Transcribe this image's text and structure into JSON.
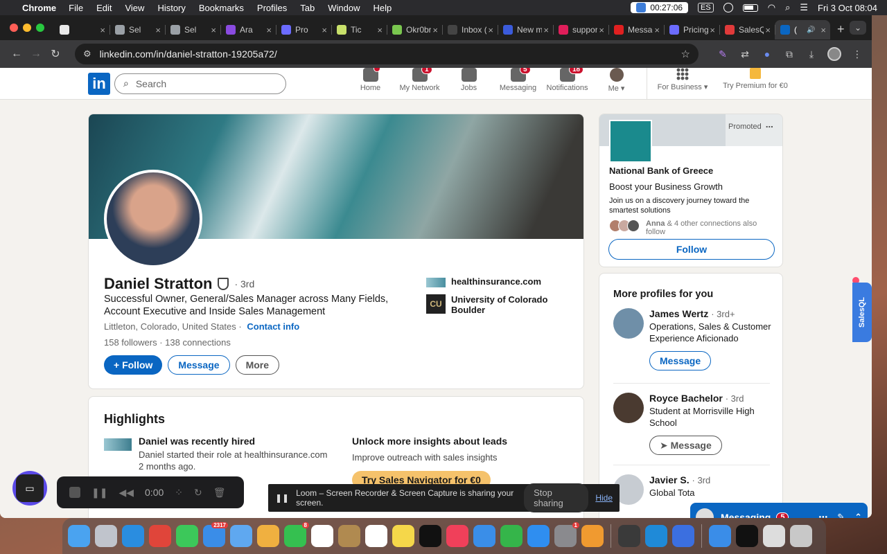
{
  "menubar": {
    "app_name": "Chrome",
    "menus": [
      "File",
      "Edit",
      "View",
      "History",
      "Bookmarks",
      "Profiles",
      "Tab",
      "Window",
      "Help"
    ],
    "timer": "00:27:06",
    "input_source": "ES",
    "datetime": "Fri 3 Oct  08:04"
  },
  "tabs": [
    {
      "label": "",
      "color": "#e9e9e9"
    },
    {
      "label": "Sel",
      "color": "#9aa0a6"
    },
    {
      "label": "Sel",
      "color": "#9aa0a6"
    },
    {
      "label": "Ara",
      "color": "#8a4be0"
    },
    {
      "label": "Pro",
      "color": "#6b6bff"
    },
    {
      "label": "Tic",
      "color": "#c8e06a"
    },
    {
      "label": "Okr0br",
      "color": "#7ac74f"
    },
    {
      "label": "Inbox (",
      "color": "#444"
    },
    {
      "label": "New m",
      "color": "#3b5bdb"
    },
    {
      "label": "suppor",
      "color": "#e01e5a"
    },
    {
      "label": "Messag",
      "color": "#e02020"
    },
    {
      "label": "Pricing",
      "color": "#6b6bff"
    },
    {
      "label": "SalesQ",
      "color": "#e03a3a"
    },
    {
      "label": "(",
      "color": "#0a66c2",
      "active": true
    }
  ],
  "address_bar": {
    "url": "linkedin.com/in/daniel-stratton-19205a72/"
  },
  "linkedin_nav": {
    "logo": "in",
    "search_placeholder": "Search",
    "items": [
      {
        "label": "Home",
        "badge": ""
      },
      {
        "label": "My Network",
        "badge": "1"
      },
      {
        "label": "Jobs",
        "badge": ""
      },
      {
        "label": "Messaging",
        "badge": "5"
      },
      {
        "label": "Notifications",
        "badge": "18"
      }
    ],
    "me_label": "Me ▾",
    "business_label": "For Business ▾",
    "premium_label": "Try Premium for €0"
  },
  "profile": {
    "name": "Daniel Stratton",
    "degree": "· 3rd",
    "headline": "Successful Owner, General/Sales Manager across Many Fields, Account Executive and Inside Sales Management",
    "location": "Littleton, Colorado, United States ·",
    "contact_info": "Contact info",
    "followers": "158 followers",
    "connections": "· 138 connections",
    "follow_label": "Follow",
    "message_label": "Message",
    "more_label": "More",
    "company": "healthinsurance.com",
    "school": "University of Colorado Boulder"
  },
  "highlights": {
    "title": "Highlights",
    "hired_title": "Daniel was recently hired",
    "hired_desc": "Daniel started their role at healthinsurance.com 2 months ago.",
    "unlock_title": "Unlock more insights about leads",
    "unlock_desc": "Improve outreach with sales insights",
    "cta": "Try Sales Navigator for €0"
  },
  "ad": {
    "promoted": "Promoted",
    "company": "National Bank of Greece",
    "tagline": "Boost your Business Growth",
    "desc": "Join us on a discovery journey toward the smartest solutions",
    "connections_name": "Anna",
    "connections_text": "& 4 other connections also follow",
    "follow_label": "Follow"
  },
  "more_profiles": {
    "title": "More profiles for you",
    "people": [
      {
        "name": "James Wertz",
        "degree": "· 3rd+",
        "headline": "Operations, Sales & Customer Experience Aficionado",
        "button": "Message"
      },
      {
        "name": "Royce Bachelor",
        "degree": "· 3rd",
        "headline": "Student at Morrisville High School",
        "button": "Message"
      },
      {
        "name": "Javier S.",
        "degree": "· 3rd",
        "headline": "Global Tota",
        "button": ""
      }
    ]
  },
  "messaging_dock": {
    "label": "Messaging",
    "count": "5"
  },
  "salesql": {
    "label": "SalesQL"
  },
  "loom": {
    "time": "0:00",
    "share_text": "Loom – Screen Recorder & Screen Capture is sharing your screen.",
    "stop_label": "Stop sharing",
    "hide_label": "Hide"
  },
  "dock": {
    "apps": [
      {
        "name": "finder",
        "color": "#4aa3f0",
        "badge": ""
      },
      {
        "name": "launchpad",
        "color": "#c0c4cc",
        "badge": ""
      },
      {
        "name": "safari",
        "color": "#2a8de0",
        "badge": ""
      },
      {
        "name": "chrome",
        "color": "#e0453a",
        "badge": ""
      },
      {
        "name": "messages",
        "color": "#3cc85a",
        "badge": ""
      },
      {
        "name": "mail",
        "color": "#3a8de8",
        "badge": "2317"
      },
      {
        "name": "app-store-alt",
        "color": "#5fa8f0",
        "badge": ""
      },
      {
        "name": "photos",
        "color": "#f0b040",
        "badge": ""
      },
      {
        "name": "facetime",
        "color": "#35c050",
        "badge": "8"
      },
      {
        "name": "calendar",
        "color": "#ffffff",
        "badge": ""
      },
      {
        "name": "contacts",
        "color": "#b08a50",
        "badge": ""
      },
      {
        "name": "reminders",
        "color": "#ffffff",
        "badge": ""
      },
      {
        "name": "notes",
        "color": "#f5d74a",
        "badge": ""
      },
      {
        "name": "tv",
        "color": "#111111",
        "badge": ""
      },
      {
        "name": "music",
        "color": "#f0405a",
        "badge": ""
      },
      {
        "name": "keynote",
        "color": "#3a8ee8",
        "badge": ""
      },
      {
        "name": "numbers",
        "color": "#35b54a",
        "badge": ""
      },
      {
        "name": "app-store",
        "color": "#2f8ef0",
        "badge": ""
      },
      {
        "name": "system-settings",
        "color": "#8a8a8e",
        "badge": "1"
      },
      {
        "name": "pages",
        "color": "#f09a30",
        "badge": ""
      },
      {
        "name": "sep",
        "color": "",
        "badge": ""
      },
      {
        "name": "quicktime",
        "color": "#3a3a3a",
        "badge": ""
      },
      {
        "name": "edge",
        "color": "#1f8ad8",
        "badge": ""
      },
      {
        "name": "loom",
        "color": "#3b6fe0",
        "badge": ""
      },
      {
        "name": "sep",
        "color": "",
        "badge": ""
      },
      {
        "name": "downloads",
        "color": "#3a8de8",
        "badge": ""
      },
      {
        "name": "window-1",
        "color": "#111111",
        "badge": ""
      },
      {
        "name": "window-2",
        "color": "#dddddd",
        "badge": ""
      },
      {
        "name": "trash",
        "color": "#c8c8c8",
        "badge": ""
      }
    ]
  }
}
